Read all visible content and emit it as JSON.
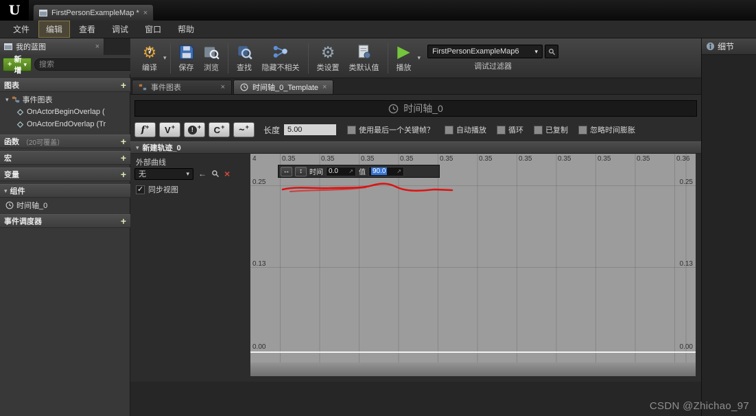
{
  "titlebar": {
    "doc_tab": "FirstPersonExampleMap *"
  },
  "menubar": {
    "items": [
      "文件",
      "编辑",
      "查看",
      "调试",
      "窗口",
      "帮助"
    ]
  },
  "toolbar": {
    "compile": "编译",
    "save": "保存",
    "browse": "浏览",
    "find": "查找",
    "hide_unrelated": "隐藏不相关",
    "class_settings": "类设置",
    "class_defaults": "类默认值",
    "play": "播放",
    "map_selector": "FirstPersonExampleMap6",
    "debug_filter": "调试过滤器"
  },
  "sidebar": {
    "title": "我的蓝图",
    "add_new": "新增",
    "search_placeholder": "搜索",
    "sections": {
      "graphs": "图表",
      "event_graph": "事件图表",
      "event_items": [
        "OnActorBeginOverlap (",
        "OnActorEndOverlap (Tr"
      ],
      "functions": "函数",
      "functions_hint": "（20可覆盖）",
      "macros": "宏",
      "variables": "变量",
      "components": "组件",
      "component_items": [
        "时间轴_0"
      ],
      "dispatchers": "事件调度器"
    }
  },
  "tabs": {
    "event_graph": "事件图表",
    "timeline_template": "时间轴_0_Template"
  },
  "timeline": {
    "title": "时间轴_0",
    "track_buttons": {
      "float_glyph": "f",
      "vector_glyph": "V",
      "event_glyph": "!",
      "color_glyph": "C",
      "curve_glyph": "~",
      "plus": "+"
    },
    "length_label": "长度",
    "length_value": "5.00",
    "chk_last_keyframe": "使用最后一个关键帧？",
    "chk_autoplay": "自动播放",
    "chk_loop": "循环",
    "chk_replicated": "已复制",
    "chk_ignore_dilation": "忽略时间膨胀",
    "track_name": "新建轨迹_0",
    "external_curve_label": "外部曲线",
    "external_curve_value": "无",
    "sync_view_label": "同步视图",
    "key_time_label": "时间",
    "key_time_value": "0.0",
    "key_value_label": "值",
    "key_value_value": "90.0"
  },
  "graph": {
    "ruler": [
      "4",
      "0.35",
      "0.35",
      "0.35",
      "0.35",
      "0.35",
      "0.35",
      "0.35",
      "0.35",
      "0.35",
      "0.35",
      "0.36"
    ],
    "y_left": [
      "0.25",
      "0.13",
      "0.00"
    ],
    "y_right": [
      "0.25",
      "0.13",
      "0.00"
    ]
  },
  "details": {
    "title": "细节"
  },
  "watermark": "CSDN @Zhichao_97"
}
